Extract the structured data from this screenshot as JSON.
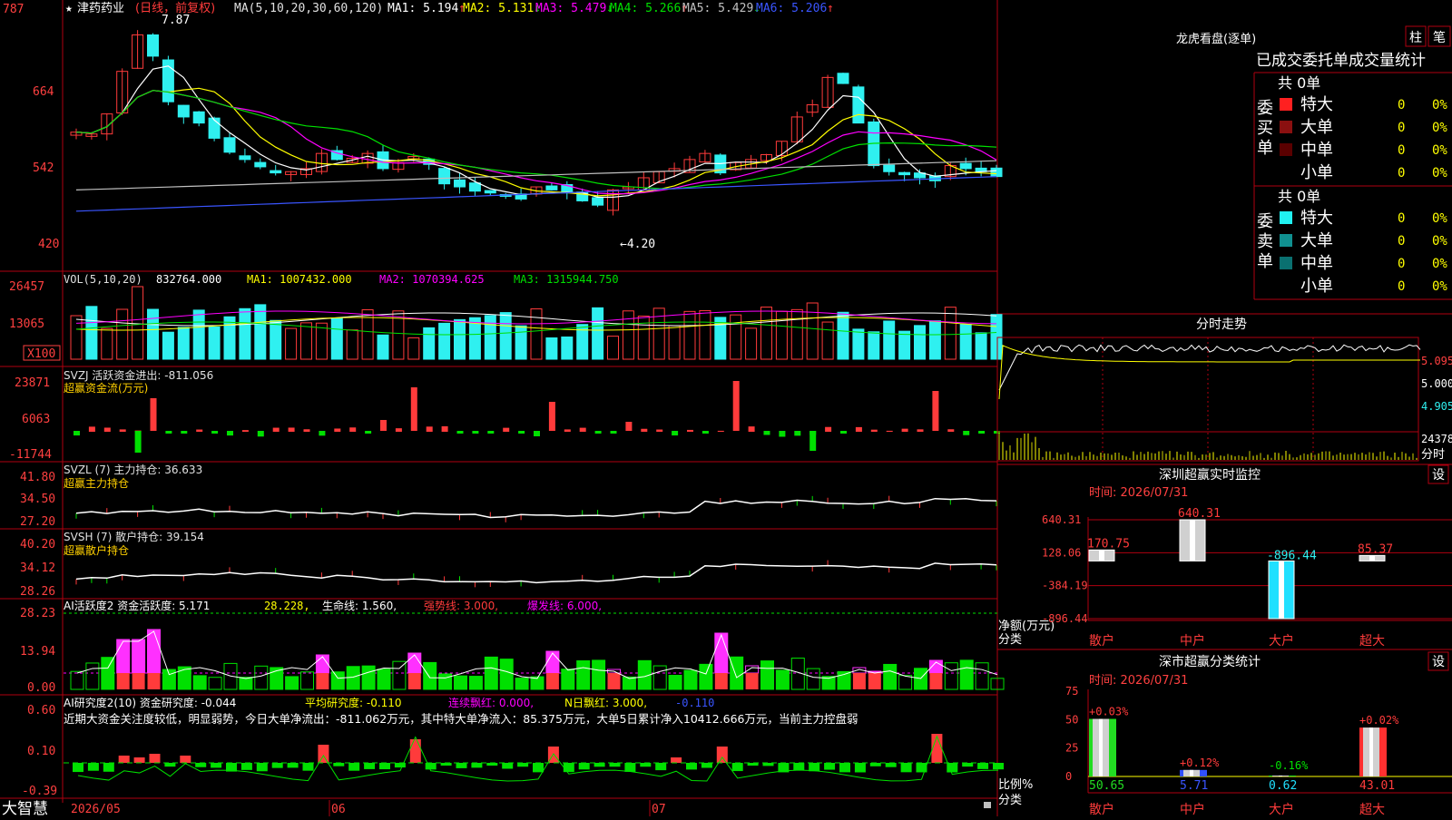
{
  "colors": {
    "up": "#ff3b3b",
    "down": "#2ff0f0",
    "grid": "#b0000f",
    "axis_text": "#ff4040",
    "white": "#ffffff",
    "yellow": "#ffff00",
    "magenta": "#ff00ff",
    "green": "#00e000",
    "blue": "#3a55ff",
    "gray": "#c0c0c0",
    "accent_label": "#ffd000"
  },
  "main_chart": {
    "title_star": "★",
    "stock_name": "津药药业",
    "period": "(日线，前复权)",
    "ma_header": "MA(5,10,20,30,60,120)",
    "ma_values": [
      {
        "label": "MA1:",
        "value": "5.194",
        "arrow": "↑",
        "color": "#ffffff"
      },
      {
        "label": "MA2:",
        "value": "5.131",
        "arrow": "↓",
        "color": "#ffff00"
      },
      {
        "label": "MA3:",
        "value": "5.479",
        "arrow": "↓",
        "color": "#ff00ff"
      },
      {
        "label": "MA4:",
        "value": "5.266",
        "arrow": "↑",
        "color": "#00e000"
      },
      {
        "label": "MA5:",
        "value": "5.429",
        "arrow": "↓",
        "color": "#c0c0c0"
      },
      {
        "label": "MA6:",
        "value": "5.206",
        "arrow": "↑",
        "color": "#3a55ff"
      }
    ],
    "y_ticks": [
      "787",
      "664",
      "542",
      "420"
    ],
    "high_label": "7.87",
    "low_label": "←4.20"
  },
  "volume_panel": {
    "header": "VOL(5,10,20)",
    "value": "832764.000",
    "ma1": "MA1: 1007432.000",
    "ma2": "MA2: 1070394.625",
    "ma3": "MA3: 1315944.750",
    "y_ticks": [
      "26457",
      "13065"
    ],
    "unit": "X100"
  },
  "svzj_panel": {
    "header": "SVZJ  活跃资金进出: -811.056",
    "subtitle": "超赢资金流(万元)",
    "y_ticks": [
      "23871",
      "6063",
      "-11744"
    ]
  },
  "svzl_panel": {
    "header": "SVZL (7) 主力持仓: 36.633",
    "subtitle": "超赢主力持仓",
    "y_ticks": [
      "41.80",
      "34.50",
      "27.20"
    ]
  },
  "svsh_panel": {
    "header": "SVSH (7) 散户持仓: 39.154",
    "subtitle": "超赢散户持仓",
    "y_ticks": [
      "40.20",
      "34.12",
      "28.26"
    ]
  },
  "ai_active_panel": {
    "header_a": "AI活跃度2 资金活跃度: 5.171",
    "header_b": "28.228,",
    "header_c": "生命线: 1.560,",
    "header_d": "强势线: 3.000,",
    "header_e": "爆发线: 6.000,",
    "y_ticks": [
      "28.23",
      "13.94",
      "0.00"
    ]
  },
  "ai_research_panel": {
    "header_a": "AI研究度2(10)  资金研究度: -0.044",
    "header_b": "平均研究度: -0.110",
    "header_c": "连续飘红: 0.000,",
    "header_d": "N日飘红: 3.000,",
    "header_e": "-0.110",
    "commentary": "近期大资金关注度较低，明显弱势，今日大单净流出：-811.062万元，其中特大单净流入：85.375万元，大单5日累计净入10412.666万元，当前主力控盘弱",
    "y_ticks": [
      "0.60",
      "0.10",
      "-0.39"
    ]
  },
  "bottom_bar": {
    "brand": "大智慧",
    "dates": [
      "2026/05",
      "06",
      "07"
    ]
  },
  "dragon_panel": {
    "title": "龙虎看盘(逐单)",
    "btn_bar": "柱",
    "btn_pen": "笔",
    "subtitle": "已成交委托单成交量统计",
    "buy_label": "委买单",
    "sell_label": "委卖单",
    "buy_total": "共 0单",
    "sell_total": "共 0单",
    "buy_rows": [
      {
        "name": "特大",
        "count": "0",
        "pct": "0%",
        "color": "#ff2020"
      },
      {
        "name": "大单",
        "count": "0",
        "pct": "0%",
        "color": "#8a1010"
      },
      {
        "name": "中单",
        "count": "0",
        "pct": "0%",
        "color": "#5a0000"
      },
      {
        "name": "小单",
        "count": "0",
        "pct": "0%",
        "color": ""
      }
    ],
    "sell_rows": [
      {
        "name": "特大",
        "count": "0",
        "pct": "0%",
        "color": "#20f0f0"
      },
      {
        "name": "大单",
        "count": "0",
        "pct": "0%",
        "color": "#109090"
      },
      {
        "name": "中单",
        "count": "0",
        "pct": "0%",
        "color": "#0a7070"
      },
      {
        "name": "小单",
        "count": "0",
        "pct": "0%",
        "color": ""
      }
    ]
  },
  "intraday_panel": {
    "title": "分时走势",
    "prices": [
      "5.095",
      "5.000",
      "4.905"
    ],
    "vol_label": "24378",
    "vol_unit": "分时"
  },
  "sz_monitor": {
    "title": "深圳超赢实时监控",
    "btn": "设",
    "time": "时间: 2026/07/31",
    "y_ticks": [
      "640.31",
      "128.06",
      "-384.19",
      "-896.44"
    ],
    "ylabel1": "净额(万元)",
    "ylabel2": "分类",
    "categories": [
      "散户",
      "中户",
      "大户",
      "超大"
    ],
    "labels": [
      "170.75",
      "640.31",
      "-896.44",
      "85.37"
    ]
  },
  "sz_class": {
    "title": "深市超赢分类统计",
    "btn": "设",
    "time": "时间: 2026/07/31",
    "y_ticks": [
      "75",
      "50",
      "25",
      "0"
    ],
    "ylabel1": "比例%",
    "ylabel2": "分类",
    "categories": [
      "散户",
      "中户",
      "大户",
      "超大"
    ],
    "top_labels": [
      "+0.03%",
      "+0.12%",
      "-0.16%",
      "+0.02%"
    ],
    "bottom_labels": [
      "50.65",
      "5.71",
      "0.62",
      "43.01"
    ]
  },
  "chart_data": [
    {
      "type": "bar",
      "title": "深圳超赢实时监控",
      "categories": [
        "散户",
        "中户",
        "大户",
        "超大"
      ],
      "values": [
        170.75,
        640.31,
        -896.44,
        85.37
      ],
      "ylabel": "净额(万元)",
      "ylim": [
        -896.44,
        640.31
      ]
    },
    {
      "type": "bar",
      "title": "深市超赢分类统计",
      "categories": [
        "散户",
        "中户",
        "大户",
        "超大"
      ],
      "values": [
        50.65,
        5.71,
        0.62,
        43.01
      ],
      "ylabel": "比例%",
      "ylim": [
        0,
        75
      ]
    }
  ]
}
